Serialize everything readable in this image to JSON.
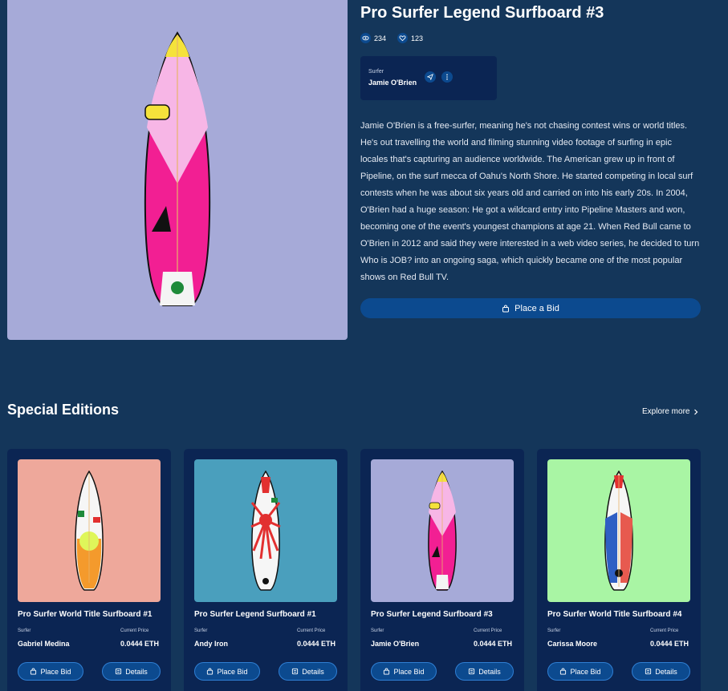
{
  "hero": {
    "title": "Pro Surfer Legend Surfboard #3",
    "views": "234",
    "likes": "123",
    "surfer_label": "Surfer",
    "surfer_name": "Jamie O'Brien",
    "description": "Jamie O'Brien is a free-surfer, meaning he's not chasing contest wins or world titles. He's out travelling the world and filming stunning video footage of surfing in epic locales that's capturing an audience worldwide. The American grew up in front of Pipeline, on the surf mecca of Oahu's North Shore. He started competing in local surf contests when he was about six years old and carried on into his early 20s. In 2004, O'Brien had a huge season: He got a wildcard entry into Pipeline Masters and won, becoming one of the event's youngest champions at age 21. When Red Bull came to O'Brien in 2012 and said they were interested in a web video series, he decided to turn Who is JOB? into an ongoing saga, which quickly became one of the most popular shows on Red Bull TV.",
    "bid_label": "Place a Bid",
    "image_bg": "#a6aad8"
  },
  "section": {
    "title": "Special Editions",
    "explore_label": "Explore more"
  },
  "cards": [
    {
      "title": "Pro Surfer World Title Surfboard #1",
      "surfer_label": "Surfer",
      "surfer": "Gabriel Medina",
      "price_label": "Current Price",
      "price": "0.0444 ETH",
      "bid_label": "Place Bid",
      "details_label": "Details",
      "bg": "#eea89b"
    },
    {
      "title": "Pro Surfer Legend Surfboard #1",
      "surfer_label": "Surfer",
      "surfer": "Andy Iron",
      "price_label": "Current Price",
      "price": "0.0444 ETH",
      "bid_label": "Place Bid",
      "details_label": "Details",
      "bg": "#4a9fbd"
    },
    {
      "title": "Pro Surfer Legend Surfboard #3",
      "surfer_label": "Surfer",
      "surfer": "Jamie O'Brien",
      "price_label": "Current Price",
      "price": "0.0444 ETH",
      "bid_label": "Place Bid",
      "details_label": "Details",
      "bg": "#a6aad8"
    },
    {
      "title": "Pro Surfer World Title Surfboard #4",
      "surfer_label": "Surfer",
      "surfer": "Carissa Moore",
      "price_label": "Current Price",
      "price": "0.0444 ETH",
      "bid_label": "Place Bid",
      "details_label": "Details",
      "bg": "#a9f5a4"
    }
  ],
  "colors": {
    "page_bg": "#14365a",
    "card_bg": "#0b2553",
    "accent": "#0c4a8f"
  }
}
